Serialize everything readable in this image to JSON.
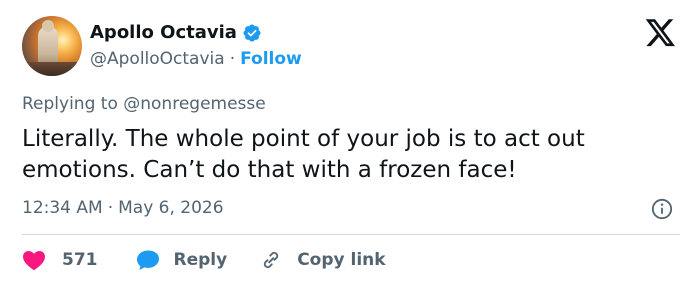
{
  "author": {
    "display_name": "Apollo Octavia",
    "handle": "@ApolloOctavia",
    "separator": "·",
    "follow_label": "Follow"
  },
  "replying": {
    "prefix": "Replying to",
    "target": "@nonregemesse"
  },
  "tweet": {
    "text": "Literally. The whole point of your job is to act out emotions. Can’t do that with a frozen face!",
    "time": "12:34 AM",
    "separator": "·",
    "date": "May 6, 2026"
  },
  "actions": {
    "like_count": "571",
    "reply_label": "Reply",
    "copy_label": "Copy link"
  },
  "colors": {
    "accent": "#1d9bf0",
    "like": "#f91880",
    "muted": "#536471",
    "text": "#0f1419",
    "divider": "#cfd9de"
  },
  "icons": [
    "verified-badge-icon",
    "x-logo-icon",
    "info-icon",
    "heart-icon",
    "reply-bubble-icon",
    "link-icon"
  ]
}
